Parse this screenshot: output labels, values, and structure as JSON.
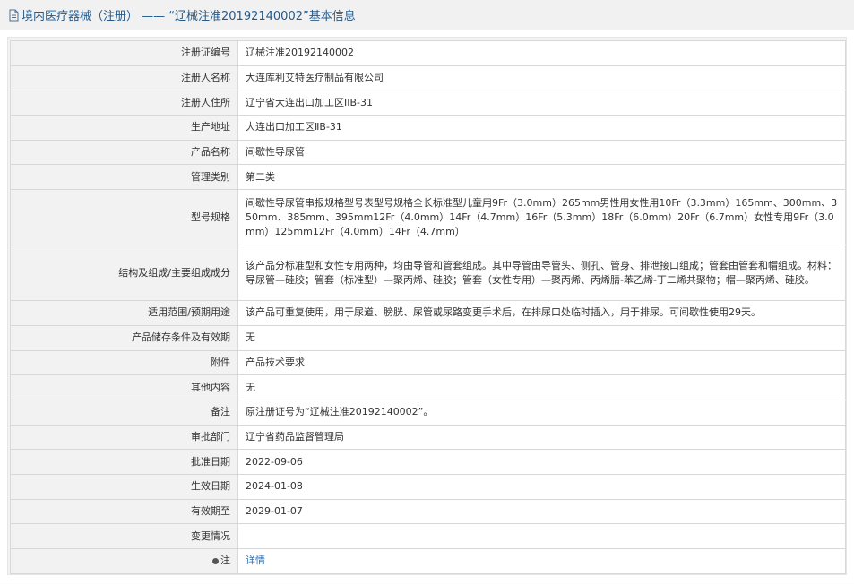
{
  "header": {
    "icon": "document-icon",
    "title": "境内医疗器械（注册） —— “辽械注准20192140002”基本信息"
  },
  "rows": [
    {
      "label": "注册证编号",
      "value": "辽械注准20192140002"
    },
    {
      "label": "注册人名称",
      "value": "大连库利艾特医疗制品有限公司"
    },
    {
      "label": "注册人住所",
      "value": "辽宁省大连出口加工区IIB-31"
    },
    {
      "label": "生产地址",
      "value": "大连出口加工区ⅡB-31"
    },
    {
      "label": "产品名称",
      "value": "间歇性导尿管"
    },
    {
      "label": "管理类别",
      "value": "第二类"
    },
    {
      "label": "型号规格",
      "value": "间歇性导尿管串报规格型号表型号规格全长标准型儿童用9Fr（3.0mm）265mm男性用女性用10Fr（3.3mm）165mm、300mm、350mm、385mm、395mm12Fr（4.0mm）14Fr（4.7mm）16Fr（5.3mm）18Fr（6.0mm）20Fr（6.7mm）女性专用9Fr（3.0mm）125mm12Fr（4.0mm）14Fr（4.7mm）"
    },
    {
      "label": "结构及组成/主要组成成分",
      "value": "该产品分标准型和女性专用两种，均由导管和管套组成。其中导管由导管头、侧孔、管身、排泄接口组成；管套由管套和帽组成。材料：导尿管—硅胶；管套（标准型）—聚丙烯、硅胶；管套（女性专用）—聚丙烯、丙烯腈-苯乙烯-丁二烯共聚物；帽—聚丙烯、硅胶。"
    },
    {
      "label": "适用范围/预期用途",
      "value": "该产品可重复使用，用于尿道、膀胱、尿管或尿路变更手术后，在排尿口处临时插入，用于排尿。可间歇性使用29天。"
    },
    {
      "label": "产品储存条件及有效期",
      "value": "无"
    },
    {
      "label": "附件",
      "value": "产品技术要求"
    },
    {
      "label": "其他内容",
      "value": "无"
    },
    {
      "label": "备注",
      "value": "原注册证号为“辽械注准20192140002”。"
    },
    {
      "label": "审批部门",
      "value": "辽宁省药品监督管理局"
    },
    {
      "label": "批准日期",
      "value": "2022-09-06"
    },
    {
      "label": "生效日期",
      "value": "2024-01-08"
    },
    {
      "label": "有效期至",
      "value": "2029-01-07"
    },
    {
      "label": "变更情况",
      "value": ""
    }
  ],
  "note": {
    "icon": "bullet-icon",
    "label": "注",
    "link_text": "详情"
  }
}
